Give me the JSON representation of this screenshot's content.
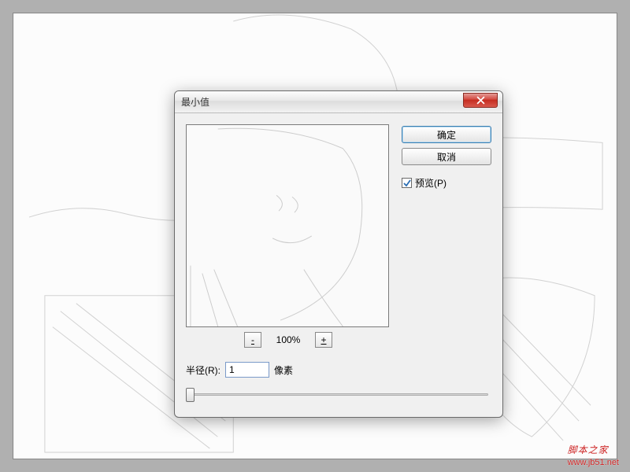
{
  "dialog": {
    "title": "最小值",
    "ok_label": "确定",
    "cancel_label": "取消",
    "preview_label": "预览(P)",
    "preview_checked": true,
    "zoom_value": "100%",
    "zoom_out_label": "-",
    "zoom_in_label": "+",
    "radius_label": "半径(R):",
    "radius_value": "1",
    "radius_unit": "像素"
  },
  "watermark": {
    "text": "脚本之家",
    "url": "www.jb51.net"
  }
}
